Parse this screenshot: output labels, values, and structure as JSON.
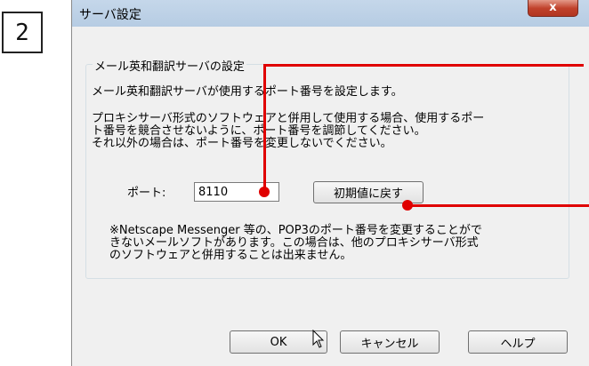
{
  "step_number": "2",
  "dialog": {
    "title": "サーバ設定",
    "close_label": "x"
  },
  "group": {
    "title": "メール英和翻訳サーバの設定",
    "line1": "メール英和翻訳サーバが使用するポート番号を設定します。",
    "para2": [
      "プロキシサーバ形式のソフトウェアと併用して使用する場合、使用するポー",
      "ト番号を競合させないように、ポート番号を調節してください。",
      "それ以外の場合は、ポート番号を変更しないでください。"
    ],
    "port_label": "ポート:",
    "port_value": "8110",
    "reset_button": "初期値に戻す",
    "note": [
      "※Netscape Messenger 等の、POP3のポート番号を変更することがで",
      "きないメールソフトがあります。この場合は、他のプロキシサーバ形式",
      "のソフトウェアと併用することは出来ません。"
    ]
  },
  "buttons": {
    "ok": "OK",
    "cancel": "キャンセル",
    "help": "ヘルプ"
  },
  "colors": {
    "callout": "#e00000",
    "dialog_bg": "#f0f0f0",
    "titlebar": "#c5d7ea",
    "close": "#c0412b"
  }
}
